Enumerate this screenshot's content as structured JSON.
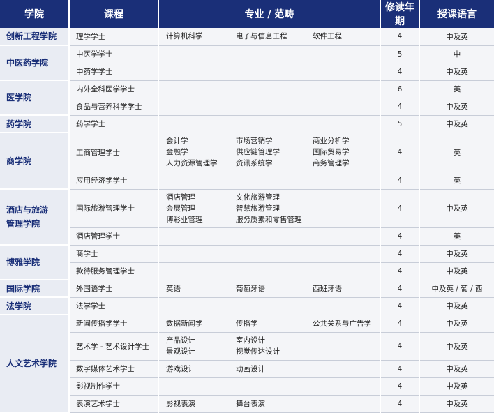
{
  "headers": [
    "学院",
    "课程",
    "专业 / 范畴",
    "修读年期",
    "授课语言"
  ],
  "colleges": [
    {
      "name": [
        "创新工程学院"
      ],
      "rows": [
        {
          "course": "理学学士",
          "majors": [
            "计算机科学",
            "电子与信息工程",
            "软件工程"
          ],
          "years": "4",
          "lang": "中及英"
        }
      ]
    },
    {
      "name": [
        "中医药学院"
      ],
      "rows": [
        {
          "course": "中医学学士",
          "majors": [],
          "years": "5",
          "lang": "中"
        },
        {
          "course": "中药学学士",
          "majors": [],
          "years": "4",
          "lang": "中及英"
        }
      ]
    },
    {
      "name": [
        "医学院"
      ],
      "rows": [
        {
          "course": "内外全科医学学士",
          "majors": [],
          "years": "6",
          "lang": "英"
        },
        {
          "course": "食品与营养科学学士",
          "majors": [],
          "years": "4",
          "lang": "中及英"
        }
      ]
    },
    {
      "name": [
        "药学院"
      ],
      "rows": [
        {
          "course": "药学学士",
          "majors": [],
          "years": "5",
          "lang": "中及英"
        }
      ]
    },
    {
      "name": [
        "商学院"
      ],
      "rows": [
        {
          "course": "工商管理学士",
          "majors": [
            "会计学",
            "市场营销学",
            "商业分析学",
            "金融学",
            "供应链管理学",
            "国际贸易学",
            "人力资源管理学",
            "资讯系统学",
            "商务管理学"
          ],
          "years": "4",
          "lang": "英"
        },
        {
          "course": "应用经济学学士",
          "majors": [],
          "years": "4",
          "lang": "英"
        }
      ]
    },
    {
      "name": [
        "酒店与旅游",
        "管理学院"
      ],
      "rows": [
        {
          "course": "国际旅游管理学士",
          "majors": [
            "酒店管理",
            "文化旅游管理",
            "",
            "会展管理",
            "智慧旅游管理",
            "",
            "博彩业管理",
            "服务质素和零售管理",
            ""
          ],
          "years": "4",
          "lang": "中及英"
        },
        {
          "course": "酒店管理学士",
          "majors": [],
          "years": "4",
          "lang": "英"
        }
      ]
    },
    {
      "name": [
        "博雅学院"
      ],
      "rows": [
        {
          "course": "商学士",
          "majors": [],
          "years": "4",
          "lang": "中及英"
        },
        {
          "course": "款待服务管理学士",
          "majors": [],
          "years": "4",
          "lang": "中及英"
        }
      ]
    },
    {
      "name": [
        "国际学院"
      ],
      "rows": [
        {
          "course": "外国语学士",
          "majors": [
            "英语",
            "葡萄牙语",
            "西班牙语"
          ],
          "years": "4",
          "lang": "中及英 / 葡 / 西"
        }
      ]
    },
    {
      "name": [
        "法学院"
      ],
      "rows": [
        {
          "course": "法学学士",
          "majors": [],
          "years": "4",
          "lang": "中及英"
        }
      ]
    },
    {
      "name": [
        "人文艺术学院"
      ],
      "rows": [
        {
          "course": "新闻传播学学士",
          "majors": [
            "数据新闻学",
            "传播学",
            "公共关系与广告学"
          ],
          "years": "4",
          "lang": "中及英"
        },
        {
          "course": "艺术学 - 艺术设计学士",
          "majors": [
            "产品设计",
            "室内设计",
            "",
            "景观设计",
            "视觉传达设计",
            ""
          ],
          "years": "4",
          "lang": "中及英"
        },
        {
          "course": "数字媒体艺术学士",
          "majors": [
            "游戏设计",
            "动画设计"
          ],
          "years": "4",
          "lang": "中及英"
        },
        {
          "course": "影视制作学士",
          "majors": [],
          "years": "4",
          "lang": "中及英"
        },
        {
          "course": "表演艺术学士",
          "majors": [
            "影视表演",
            "舞台表演"
          ],
          "years": "4",
          "lang": "中及英"
        }
      ]
    }
  ]
}
